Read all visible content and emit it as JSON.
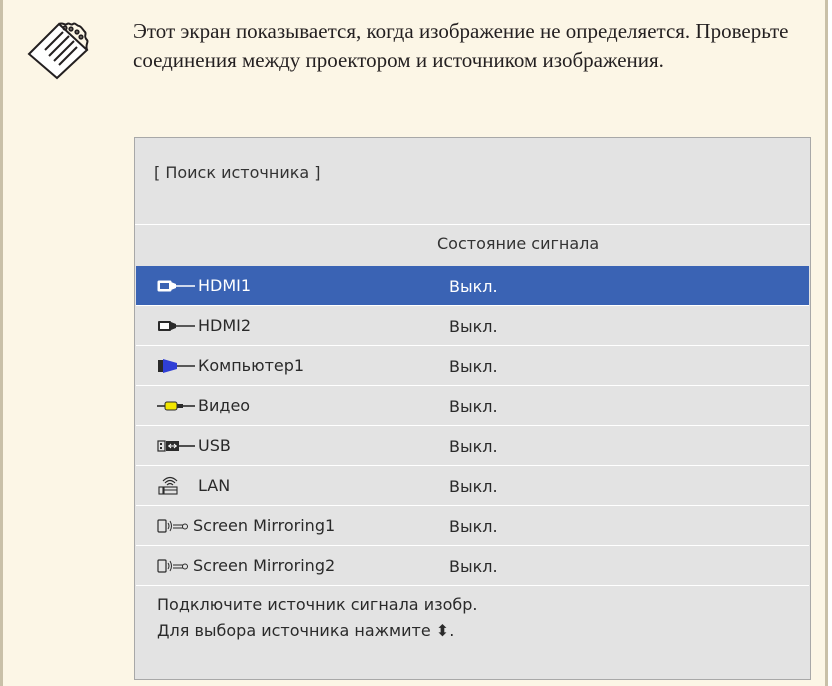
{
  "note": {
    "icon": "note-icon",
    "text": "Этот экран показывается, когда изображение не определяется. Проверьте соединения между проектором и источником изображения."
  },
  "osd": {
    "title": "[ Поиск источника ]",
    "status_header": "Состояние сигнала",
    "selected_color": "#3a63b4",
    "sources": [
      {
        "icon": "hdmi-icon",
        "name": "HDMI1",
        "status": "Выкл.",
        "selected": true
      },
      {
        "icon": "hdmi-icon",
        "name": "HDMI2",
        "status": "Выкл.",
        "selected": false
      },
      {
        "icon": "vga-computer-icon",
        "name": "Компьютер1",
        "status": "Выкл.",
        "selected": false
      },
      {
        "icon": "rca-video-icon",
        "name": "Видео",
        "status": "Выкл.",
        "selected": false
      },
      {
        "icon": "usb-icon",
        "name": "USB",
        "status": "Выкл.",
        "selected": false
      },
      {
        "icon": "lan-wireless-icon",
        "name": "LAN",
        "status": "Выкл.",
        "selected": false
      },
      {
        "icon": "screen-mirroring-icon",
        "name": "Screen Mirroring1",
        "status": "Выкл.",
        "selected": false
      },
      {
        "icon": "screen-mirroring-icon",
        "name": "Screen Mirroring2",
        "status": "Выкл.",
        "selected": false
      }
    ],
    "footer_line1": "Подключите источник сигнала изобр.",
    "footer_line2": "Для выбора источника нажмите",
    "footer_arrow_icon": "up-down-arrow-icon",
    "footer_arrow_glyph": "⬍",
    "footer_end": "."
  }
}
